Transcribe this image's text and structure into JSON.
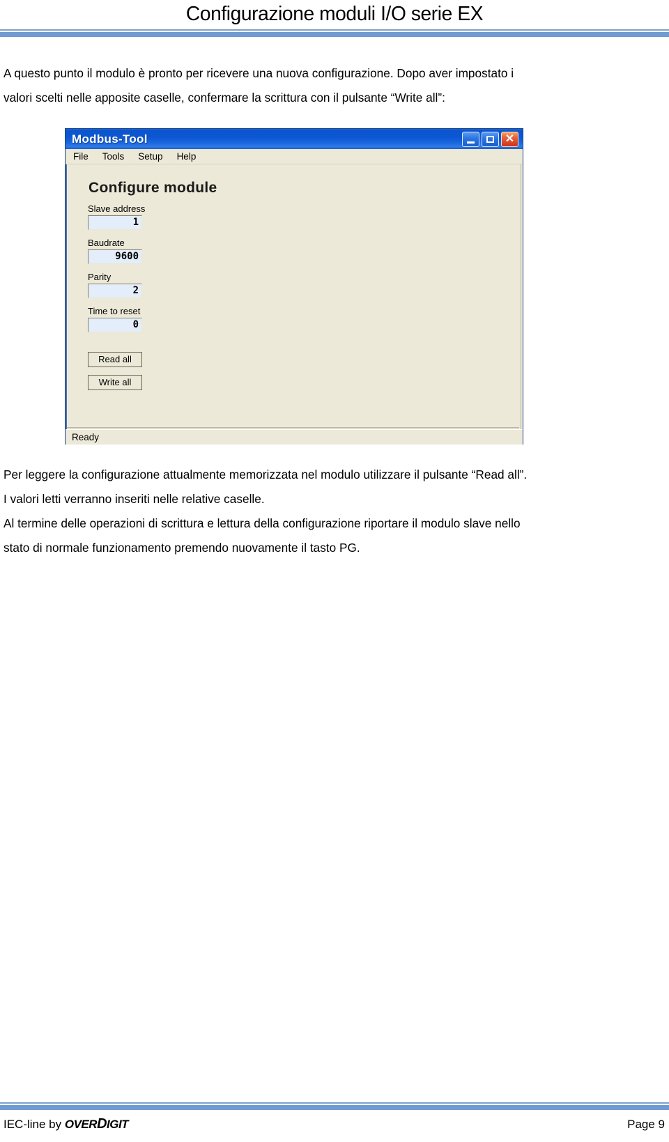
{
  "header": {
    "title": "Configurazione moduli I/O serie EX"
  },
  "intro": {
    "line1": "A questo punto il modulo è pronto per ricevere una nuova configurazione. Dopo aver impostato i",
    "line2": "valori scelti nelle apposite caselle, confermare la scrittura con il pulsante “Write all”:"
  },
  "app_window": {
    "title": "Modbus-Tool",
    "window_controls": {
      "minimize": "minimize-icon",
      "maximize": "maximize-icon",
      "close": "✕"
    },
    "menu": [
      "File",
      "Tools",
      "Setup",
      "Help"
    ],
    "form": {
      "heading": "Configure module",
      "fields": [
        {
          "label": "Slave address",
          "value": "1"
        },
        {
          "label": "Baudrate",
          "value": "9600"
        },
        {
          "label": "Parity",
          "value": "2"
        },
        {
          "label": "Time to reset",
          "value": "0"
        }
      ],
      "buttons": [
        {
          "label": "Read all"
        },
        {
          "label": "Write all"
        }
      ]
    },
    "status": "Ready"
  },
  "outro": {
    "line1": "Per leggere la configurazione attualmente memorizzata nel modulo utilizzare il pulsante “Read all”.",
    "line2": "I valori letti verranno inseriti nelle relative caselle.",
    "line3": "Al termine delle operazioni di scrittura e lettura della configurazione riportare il modulo slave nello",
    "line4": "stato di normale funzionamento premendo nuovamente il tasto PG."
  },
  "footer": {
    "prefix": "IEC-line by ",
    "brand_over": "OVER",
    "brand_d": "D",
    "brand_igit": "IGIT",
    "page": "Page 9"
  },
  "colors": {
    "rule_blue": "#6f9bd1",
    "titlebar_blue": "#0c56d2",
    "window_face": "#ece9d8",
    "input_fill": "#e4eefa",
    "close_red": "#c9331c"
  }
}
